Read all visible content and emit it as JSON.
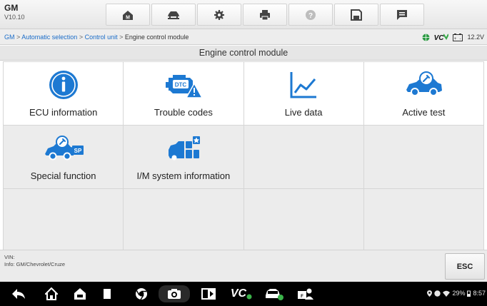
{
  "app": {
    "name": "GM",
    "version": "V10.10"
  },
  "toolbar": {
    "items": [
      {
        "icon": "home-icon"
      },
      {
        "icon": "vehicle-lift-icon"
      },
      {
        "icon": "settings-icon"
      },
      {
        "icon": "print-icon"
      },
      {
        "icon": "help-icon"
      },
      {
        "icon": "save-icon"
      },
      {
        "icon": "message-icon"
      }
    ]
  },
  "breadcrumb": {
    "link1": "GM",
    "sep": " > ",
    "link2": "Automatic selection",
    "link3": "Control unit",
    "current": "Engine control module"
  },
  "status": {
    "vcb": "VC",
    "voltage": "12.2V"
  },
  "section_title": "Engine control module",
  "tiles": [
    {
      "label": "ECU information",
      "icon": "info-icon"
    },
    {
      "label": "Trouble codes",
      "icon": "engine-dtc-icon"
    },
    {
      "label": "Live data",
      "icon": "line-chart-icon"
    },
    {
      "label": "Active test",
      "icon": "car-wrench-icon"
    },
    {
      "label": "Special function",
      "icon": "car-sp-icon"
    },
    {
      "label": "I/M system information",
      "icon": "im-system-icon"
    }
  ],
  "vin_label": "VIN:",
  "info_label": "Info: GM/Chevrolet/Cruze",
  "esc_label": "ESC",
  "nav": {
    "vci": "VC",
    "battery": "29%",
    "time": "8:57"
  },
  "colors": {
    "accent": "#1a6cc8",
    "icon_blue": "#1d79d2",
    "warning": "#1d79d2"
  }
}
